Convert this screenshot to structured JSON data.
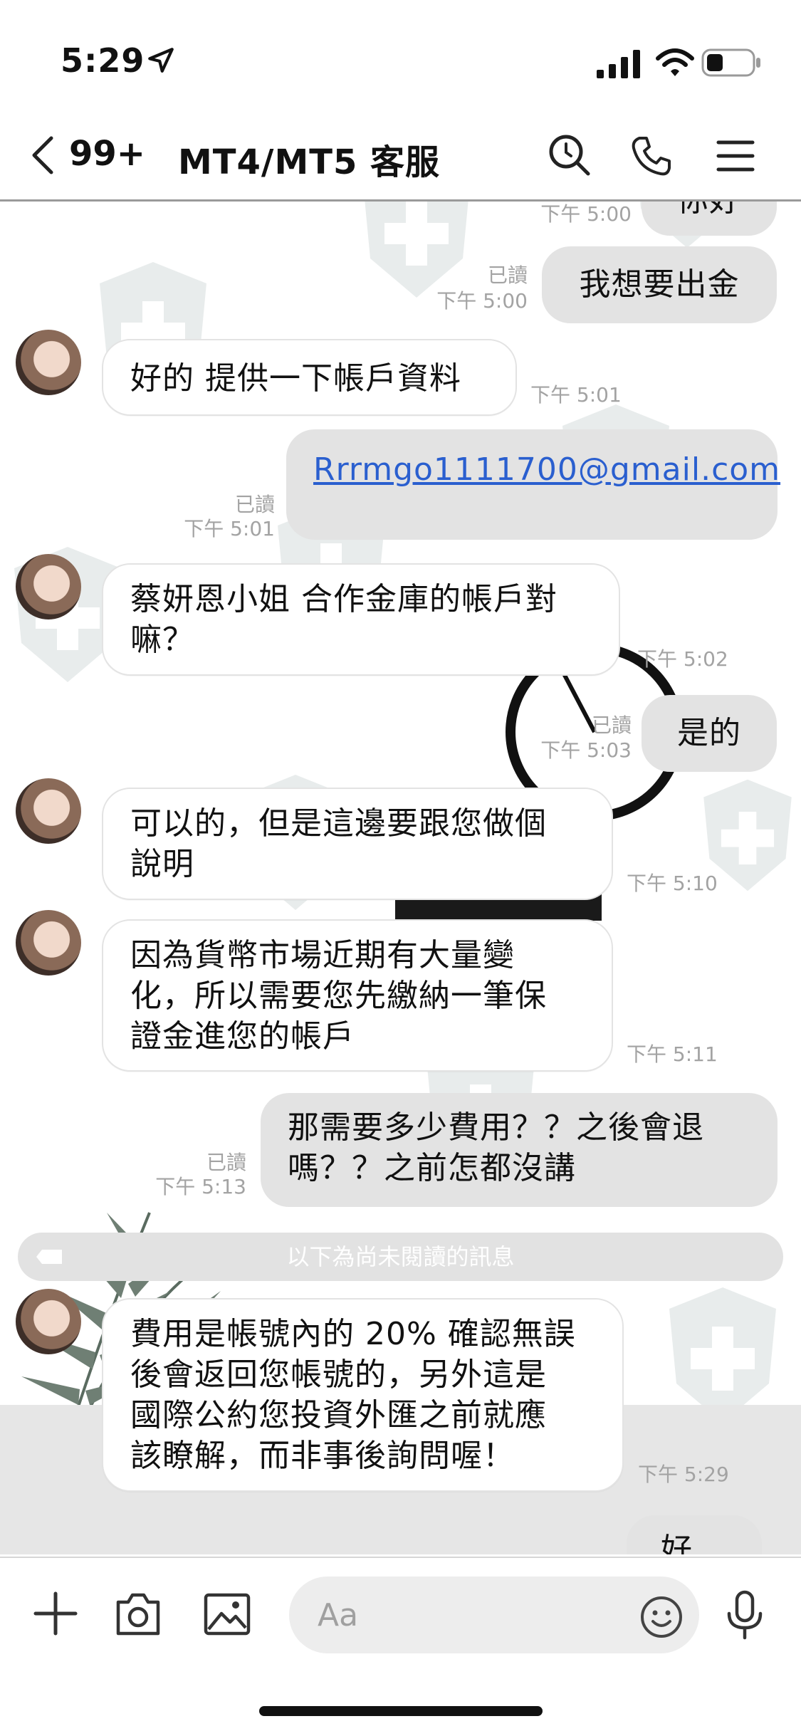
{
  "status_bar": {
    "time": "5:29"
  },
  "header": {
    "back_count": "99+",
    "title": "MT4/MT5 客服"
  },
  "messages": [
    {
      "id": "m0",
      "side": "out",
      "text": "你好",
      "time": "下午 5:00"
    },
    {
      "id": "m1",
      "side": "out",
      "text": "我想要出金",
      "read": "已讀",
      "time": "下午 5:00"
    },
    {
      "id": "m2",
      "side": "in",
      "text": "好的 提供一下帳戶資料",
      "time": "下午 5:01"
    },
    {
      "id": "m3",
      "side": "out",
      "text": "Rrrmgo1111700@gmail.com",
      "read": "已讀",
      "time": "下午 5:01"
    },
    {
      "id": "m4",
      "side": "in",
      "lines": [
        "蔡妍恩小姐 合作金庫的帳戶對",
        "嘛？"
      ],
      "time": "下午 5:02"
    },
    {
      "id": "m5",
      "side": "out",
      "text": "是的",
      "read": "已讀",
      "time": "下午 5:03"
    },
    {
      "id": "m6",
      "side": "in",
      "lines": [
        "可以的，但是這邊要跟您做個",
        "說明"
      ],
      "time": "下午 5:10"
    },
    {
      "id": "m7",
      "side": "in",
      "lines": [
        "因為貨幣市場近期有大量變",
        "化，所以需要您先繳納一筆保",
        "證金進您的帳戶"
      ],
      "time": "下午 5:11"
    },
    {
      "id": "m8",
      "side": "out",
      "lines": [
        "那需要多少費用？？之後會退",
        "嗎？？之前怎都沒講"
      ],
      "read": "已讀",
      "time": "下午 5:13"
    },
    {
      "id": "m9",
      "side": "in",
      "lines": [
        "費用是帳號內的 20% 確認無誤",
        "後會返回您帳號的，另外這是",
        "國際公約您投資外匯之前就應",
        "該瞭解，而非事後詢問喔！"
      ],
      "time": "下午 5:29"
    },
    {
      "id": "m10",
      "side": "out",
      "text": "好"
    }
  ],
  "unread_divider": "以下為尚未閱讀的訊息",
  "input": {
    "placeholder": "Aa"
  },
  "colors": {
    "incoming_bubble": "#ffffff",
    "outgoing_bubble": "#e3e3e3",
    "link": "#2a5fcf",
    "meta_text": "#a3a3a3"
  }
}
